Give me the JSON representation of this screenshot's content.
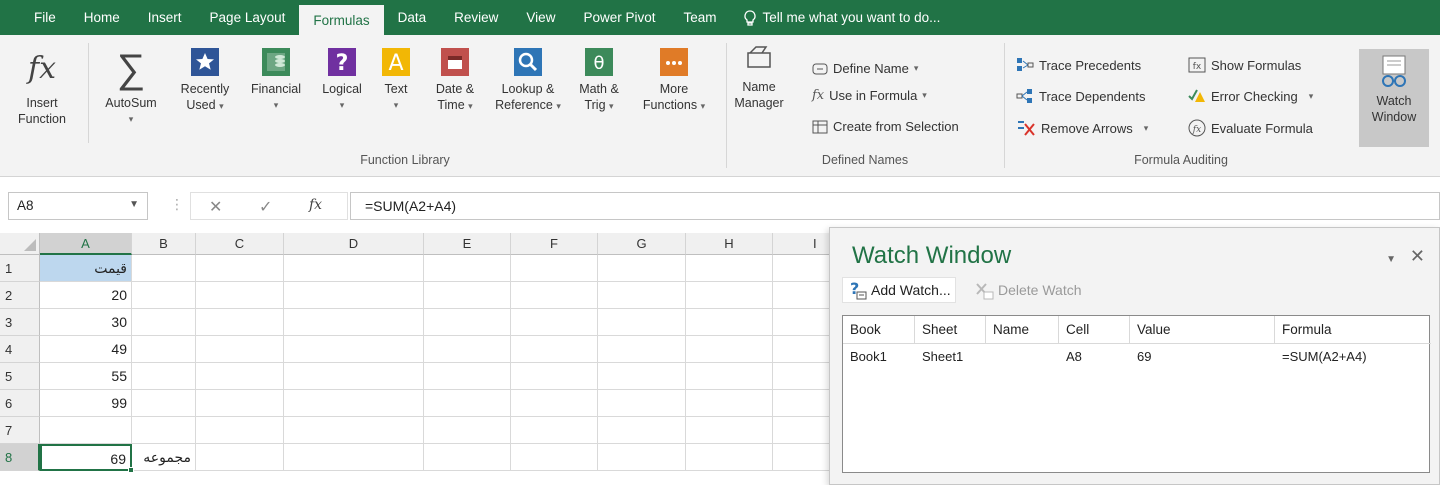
{
  "menu": {
    "tabs": [
      "File",
      "Home",
      "Insert",
      "Page Layout",
      "Formulas",
      "Data",
      "Review",
      "View",
      "Power Pivot",
      "Team"
    ],
    "active_tab": "Formulas",
    "tell_me": "Tell me what you want to do..."
  },
  "ribbon": {
    "insert_function": [
      "Insert",
      "Function"
    ],
    "autosum": "AutoSum",
    "recently_used": [
      "Recently",
      "Used"
    ],
    "financial": "Financial",
    "logical": "Logical",
    "text": "Text",
    "date_time": [
      "Date &",
      "Time"
    ],
    "lookup_reference": [
      "Lookup &",
      "Reference"
    ],
    "math_trig": [
      "Math &",
      "Trig"
    ],
    "more_functions": [
      "More",
      "Functions"
    ],
    "function_library_label": "Function Library",
    "name_manager": [
      "Name",
      "Manager"
    ],
    "define_name": "Define Name",
    "use_in_formula": "Use in Formula",
    "create_from_selection": "Create from Selection",
    "defined_names_label": "Defined Names",
    "trace_precedents": "Trace Precedents",
    "trace_dependents": "Trace Dependents",
    "remove_arrows": "Remove Arrows",
    "show_formulas": "Show Formulas",
    "error_checking": "Error Checking",
    "evaluate_formula": "Evaluate Formula",
    "formula_auditing_label": "Formula Auditing",
    "watch_window": [
      "Watch",
      "Window"
    ],
    "accent": "#217346"
  },
  "formula_bar": {
    "name_box": "A8",
    "formula": "=SUM(A2+A4)"
  },
  "sheet": {
    "columns": [
      "A",
      "B",
      "C",
      "D",
      "E",
      "F",
      "G",
      "H",
      "I"
    ],
    "rows": [
      "1",
      "2",
      "3",
      "4",
      "5",
      "6",
      "7",
      "8"
    ],
    "a_values": [
      "قیمت",
      "20",
      "30",
      "49",
      "55",
      "99",
      "",
      "69"
    ],
    "b8": "مجموعه"
  },
  "watch": {
    "title": "Watch Window",
    "add_watch": "Add Watch...",
    "delete_watch": "Delete Watch",
    "headers": [
      "Book",
      "Sheet",
      "Name",
      "Cell",
      "Value",
      "Formula"
    ],
    "row": [
      "Book1",
      "Sheet1",
      "",
      "A8",
      "69",
      "=SUM(A2+A4)"
    ]
  }
}
